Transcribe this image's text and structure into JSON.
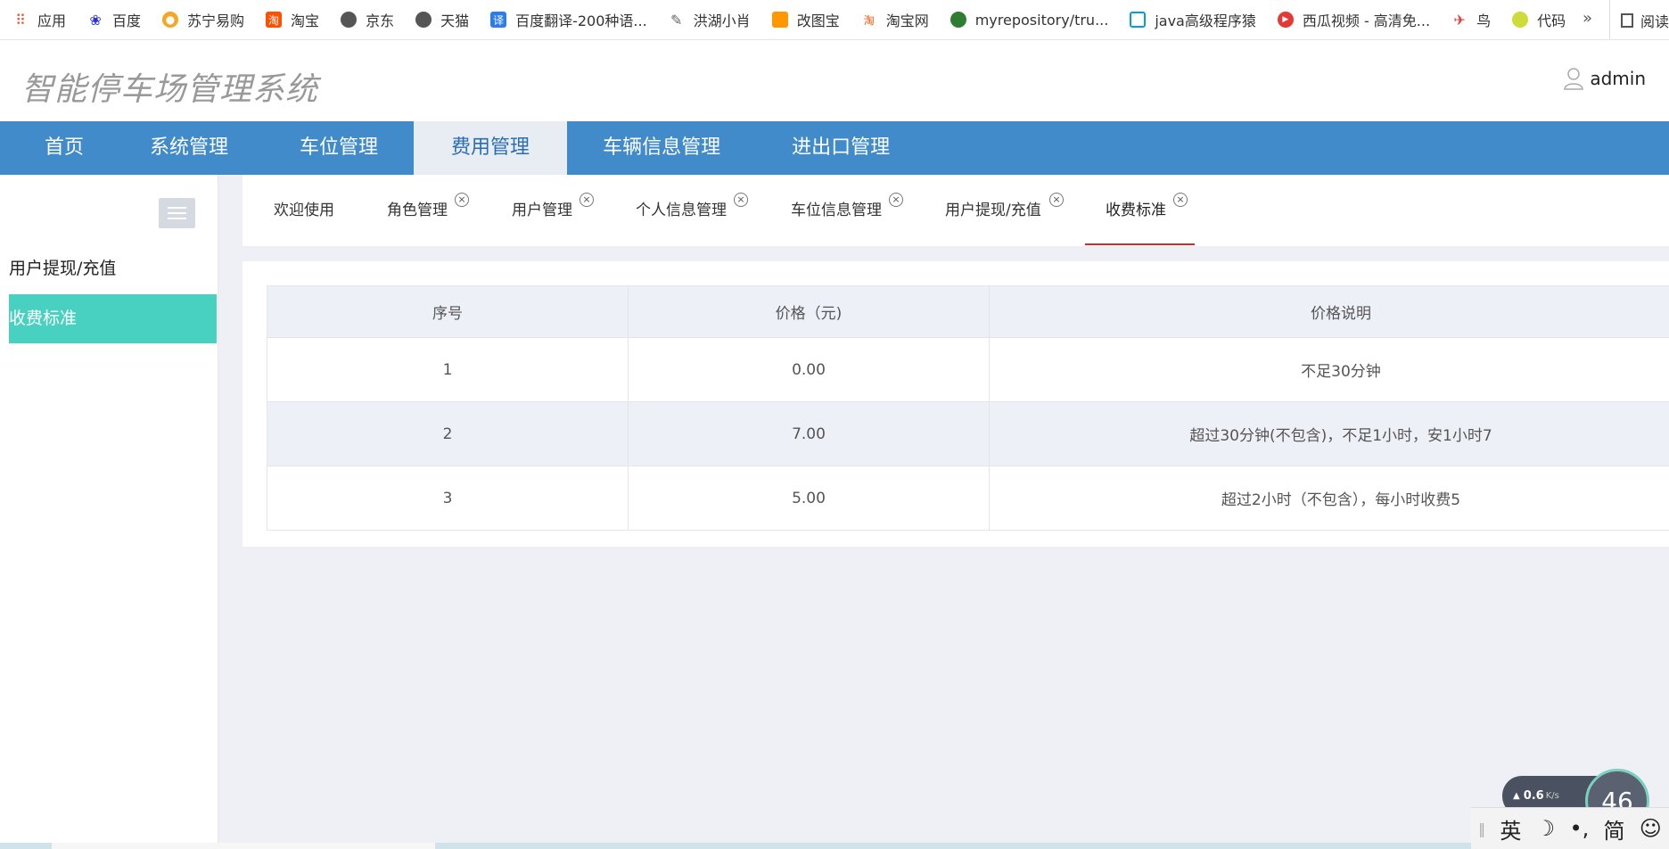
{
  "bookmarks": [
    {
      "label": "应用",
      "icon": "apps-grid-icon",
      "color": "#e4572e"
    },
    {
      "label": "百度",
      "icon": "baidu-paw-icon",
      "color": "#2932e1"
    },
    {
      "label": "苏宁易购",
      "icon": "suning-lion-icon",
      "color": "#f5a623"
    },
    {
      "label": "淘宝",
      "icon": "taobao-icon",
      "color": "#ff5000"
    },
    {
      "label": "京东",
      "icon": "globe-icon",
      "color": "#555555"
    },
    {
      "label": "天猫",
      "icon": "globe-icon",
      "color": "#555555"
    },
    {
      "label": "百度翻译-200种语...",
      "icon": "translate-icon",
      "color": "#2b7de9"
    },
    {
      "label": "洪湖小肖",
      "icon": "feather-icon",
      "color": "#666666"
    },
    {
      "label": "改图宝",
      "icon": "image-edit-icon",
      "color": "#ff9800"
    },
    {
      "label": "淘宝网",
      "icon": "taobao-icon",
      "color": "#ff5000"
    },
    {
      "label": "myrepository/tru...",
      "icon": "chrome-icon",
      "color": "#2e7d32"
    },
    {
      "label": "java高级程序猿",
      "icon": "bilibili-tv-icon",
      "color": "#00a1d6"
    },
    {
      "label": "西瓜视频 - 高清免...",
      "icon": "xigua-play-icon",
      "color": "#e53935"
    },
    {
      "label": "鸟",
      "icon": "bird-icon",
      "color": "#e53935"
    },
    {
      "label": "代码",
      "icon": "code-bookmark-icon",
      "color": "#cddc39"
    }
  ],
  "bookmarks_more": "»",
  "reader_label": "阅读",
  "header": {
    "title": "智能停车场管理系统",
    "username": "admin"
  },
  "topnav": [
    "首页",
    "系统管理",
    "车位管理",
    "费用管理",
    "车辆信息管理",
    "进出口管理"
  ],
  "active_nav": "费用管理",
  "sidebar": {
    "items": [
      "用户提现/充值",
      "收费标准"
    ],
    "active": "收费标准"
  },
  "tabs": [
    {
      "label": "欢迎使用",
      "closable": false
    },
    {
      "label": "角色管理",
      "closable": true
    },
    {
      "label": "用户管理",
      "closable": true
    },
    {
      "label": "个人信息管理",
      "closable": true
    },
    {
      "label": "车位信息管理",
      "closable": true
    },
    {
      "label": "用户提现/充值",
      "closable": true
    },
    {
      "label": "收费标准",
      "closable": true
    }
  ],
  "active_tab": "收费标准",
  "table": {
    "columns": [
      "序号",
      "价格（元)",
      "价格说明"
    ],
    "rows": [
      [
        "1",
        "0.00",
        "不足30分钟"
      ],
      [
        "2",
        "7.00",
        "超过30分钟(不包含)，不足1小时，安1小时7"
      ],
      [
        "3",
        "5.00",
        "超过2小时（不包含），每小时收费5"
      ]
    ]
  },
  "widgets": {
    "net_speed": "0.6",
    "net_unit": "K/s",
    "gauge": "46",
    "ime": [
      "英",
      "☽",
      "•,",
      "简",
      "☺"
    ]
  },
  "colors": {
    "nav_bg": "#428bca",
    "sidebar_active": "#48d1c0",
    "tab_underline": "#c9302c",
    "content_bg": "#eef0f6"
  }
}
